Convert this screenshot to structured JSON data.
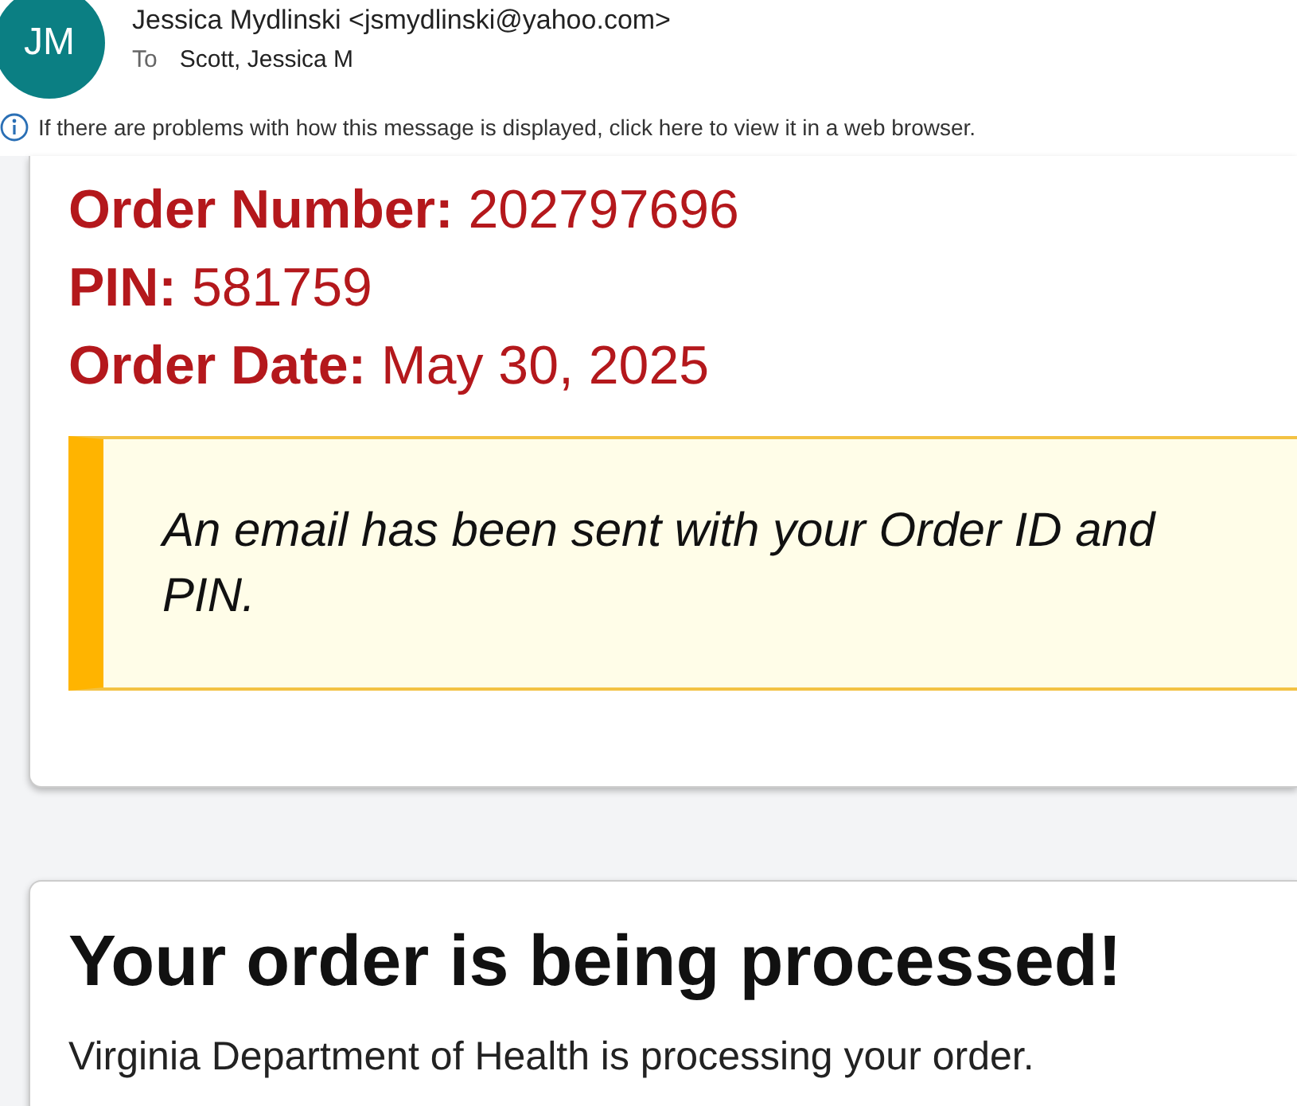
{
  "sender": {
    "initials": "JM",
    "name": "Jessica Mydlinski <jsmydlinski@yahoo.com>",
    "to_label": "To",
    "recipients": "Scott, Jessica M"
  },
  "info_bar": {
    "text": "If there are problems with how this message is displayed, click here to view it in a web browser."
  },
  "order_card": {
    "fields": [
      {
        "label": "Order Number:",
        "value": "202797696"
      },
      {
        "label": "PIN:",
        "value": "581759"
      },
      {
        "label": "Order Date:",
        "value": "May 30, 2025"
      }
    ],
    "notice": "An email has been sent with your Order ID and PIN."
  },
  "status_card": {
    "heading": "Your order is being processed!",
    "message": "Virginia Department of Health is processing your order."
  }
}
